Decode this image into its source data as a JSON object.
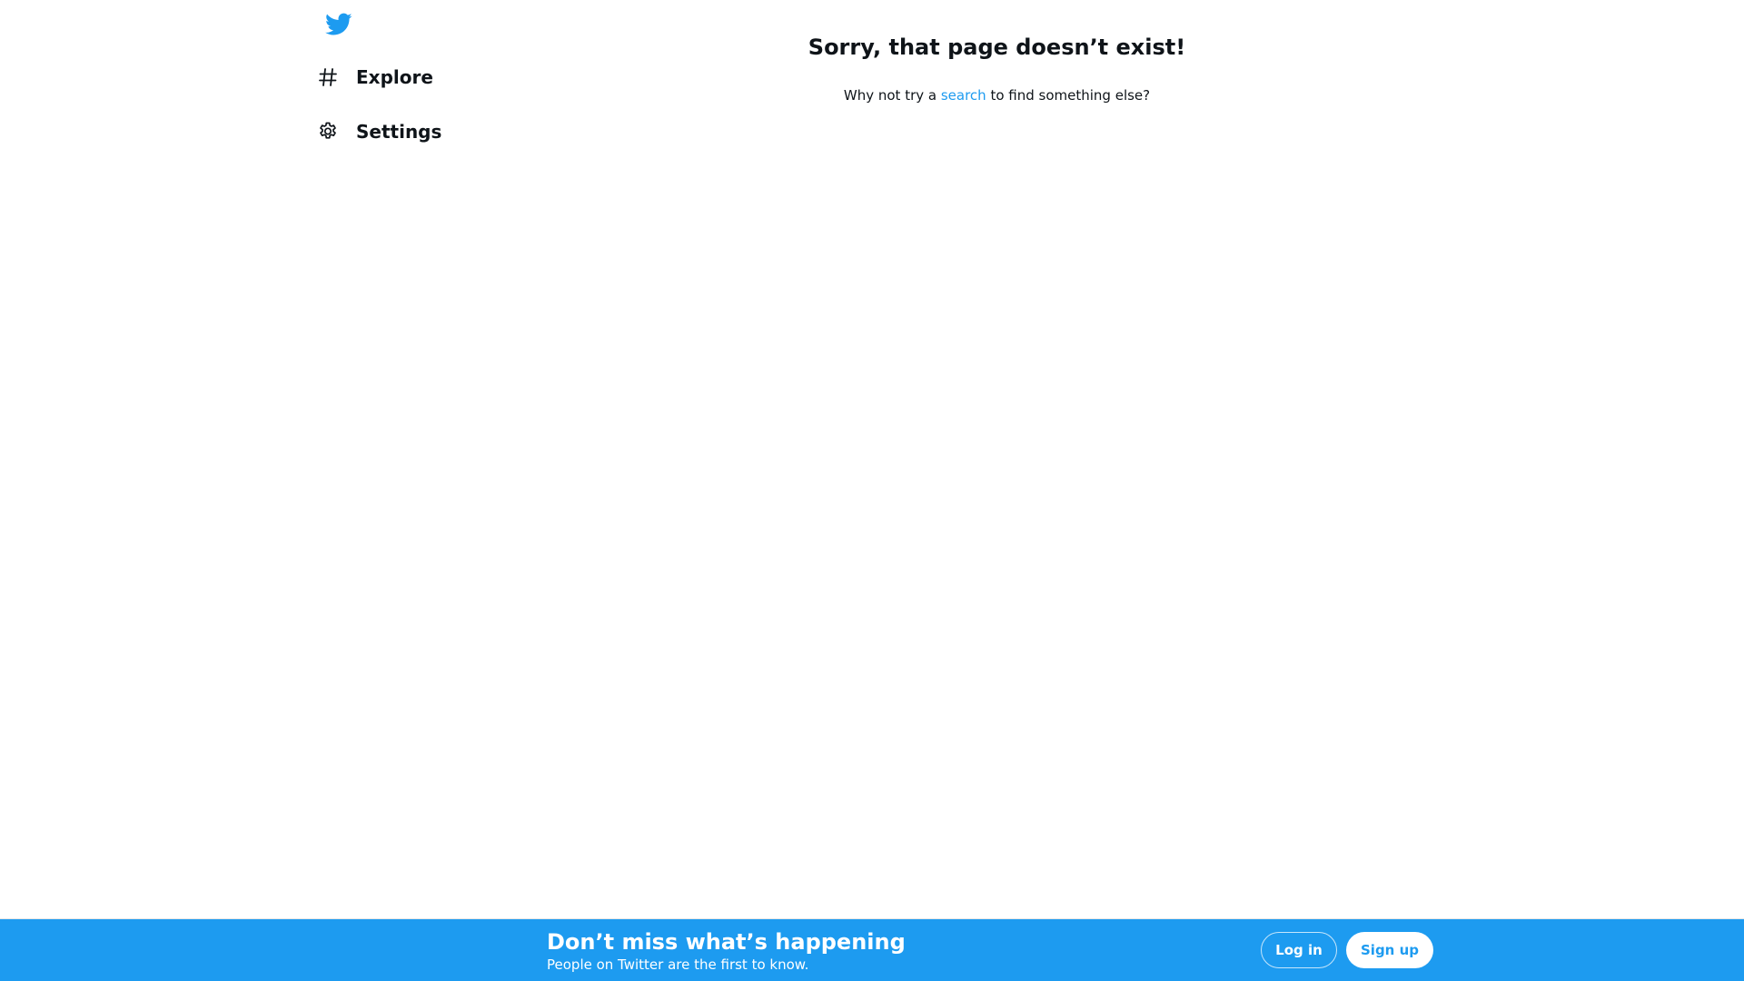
{
  "sidebar": {
    "logo_icon": "twitter-bird-icon",
    "items": [
      {
        "label": "Explore",
        "icon": "hashtag-icon"
      },
      {
        "label": "Settings",
        "icon": "gear-icon"
      }
    ]
  },
  "main": {
    "title": "Sorry, that page doesn’t exist!",
    "message_before": "Why not try a ",
    "search_link": "search",
    "message_after": " to find something else?"
  },
  "bottom_bar": {
    "title": "Don’t miss what’s happening",
    "subtitle": "People on Twitter are the first to know.",
    "login_label": "Log in",
    "signup_label": "Sign up"
  },
  "colors": {
    "brand": "#1d9bf0",
    "text": "#0f1419"
  }
}
